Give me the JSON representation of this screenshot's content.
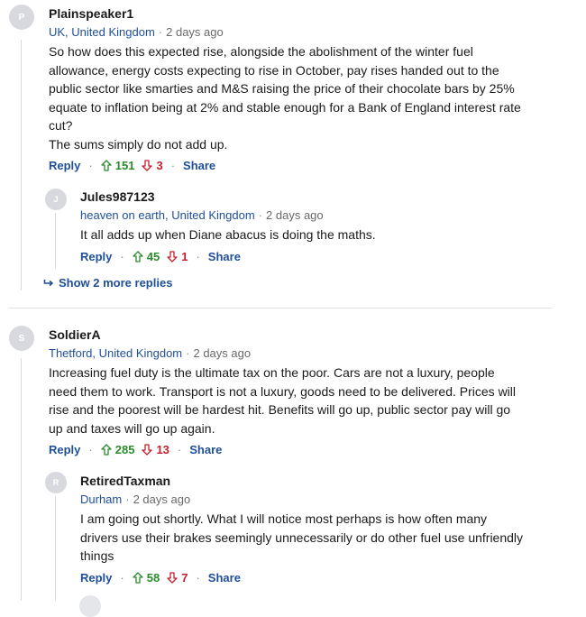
{
  "comments": [
    {
      "avatar_letter": "P",
      "username": "Plainspeaker1",
      "location": "UK, United Kingdom",
      "time": "2 days ago",
      "body": [
        "So how does this expected rise, alongside the abolishment of the winter fuel",
        "allowance, energy costs expecting to rise in October, pay rises handed out to the",
        "public sector like smarties and M&S raising the price of their chocolate bars by 25%",
        "equate to inflation being at 2% and stable enough for a Bank of England interest rate",
        "cut?",
        "The sums simply do not add up."
      ],
      "reply_label": "Reply",
      "upvotes": "151",
      "downvotes": "3",
      "share_label": "Share",
      "replies": [
        {
          "avatar_letter": "J",
          "username": "Jules987123",
          "location": "heaven on earth, United Kingdom",
          "time": "2 days ago",
          "body": [
            "It all adds up when Diane abacus is doing the maths."
          ],
          "reply_label": "Reply",
          "upvotes": "45",
          "downvotes": "1",
          "share_label": "Share"
        }
      ],
      "show_more_label": "Show 2 more replies"
    },
    {
      "avatar_letter": "S",
      "username": "SoldierA",
      "location": "Thetford, United Kingdom",
      "time": "2 days ago",
      "body": [
        "Increasing fuel duty is the ultimate tax on the poor. Cars are not a luxury, people",
        "need them to work. Transport is not a luxury, goods need to be delivered. Prices will",
        "rise and the poorest will be hardest hit. Benefits will go up, public sector pay will go",
        "up and taxes will go up again."
      ],
      "reply_label": "Reply",
      "upvotes": "285",
      "downvotes": "13",
      "share_label": "Share",
      "replies": [
        {
          "avatar_letter": "R",
          "username": "RetiredTaxman",
          "location": "Durham",
          "time": "2 days ago",
          "body": [
            "I am going out shortly. What I will notice most perhaps is how often many",
            "drivers use their brakes seemingly unnecessarily or do other fuel use unfriendly",
            "things"
          ],
          "reply_label": "Reply",
          "upvotes": "58",
          "downvotes": "7",
          "share_label": "Share"
        }
      ]
    }
  ]
}
